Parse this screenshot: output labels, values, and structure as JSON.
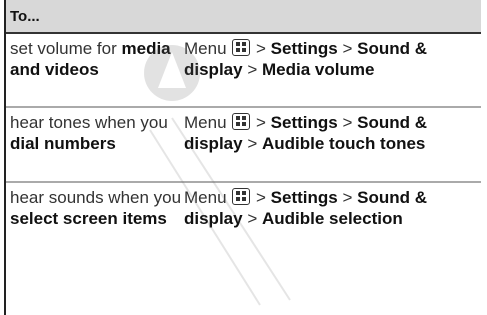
{
  "header": "To...",
  "rows": [
    {
      "to_pre": "set volume for ",
      "to_bold": "media and videos",
      "menu": "Menu",
      "path1": "Settings",
      "path2": "Sound & display",
      "path3": "Media volume"
    },
    {
      "to_pre": "hear tones when you ",
      "to_bold": "dial numbers",
      "menu": "Menu",
      "path1": "Settings",
      "path2": "Sound & display",
      "path3": "Audible touch tones"
    },
    {
      "to_pre": "hear sounds when you ",
      "to_bold": "select screen items",
      "menu": "Menu",
      "path1": "Settings",
      "path2": "Sound & display",
      "path3": "Audible selection"
    }
  ],
  "separator": ">",
  "icons": {
    "menu_key": "menu-key-icon"
  }
}
